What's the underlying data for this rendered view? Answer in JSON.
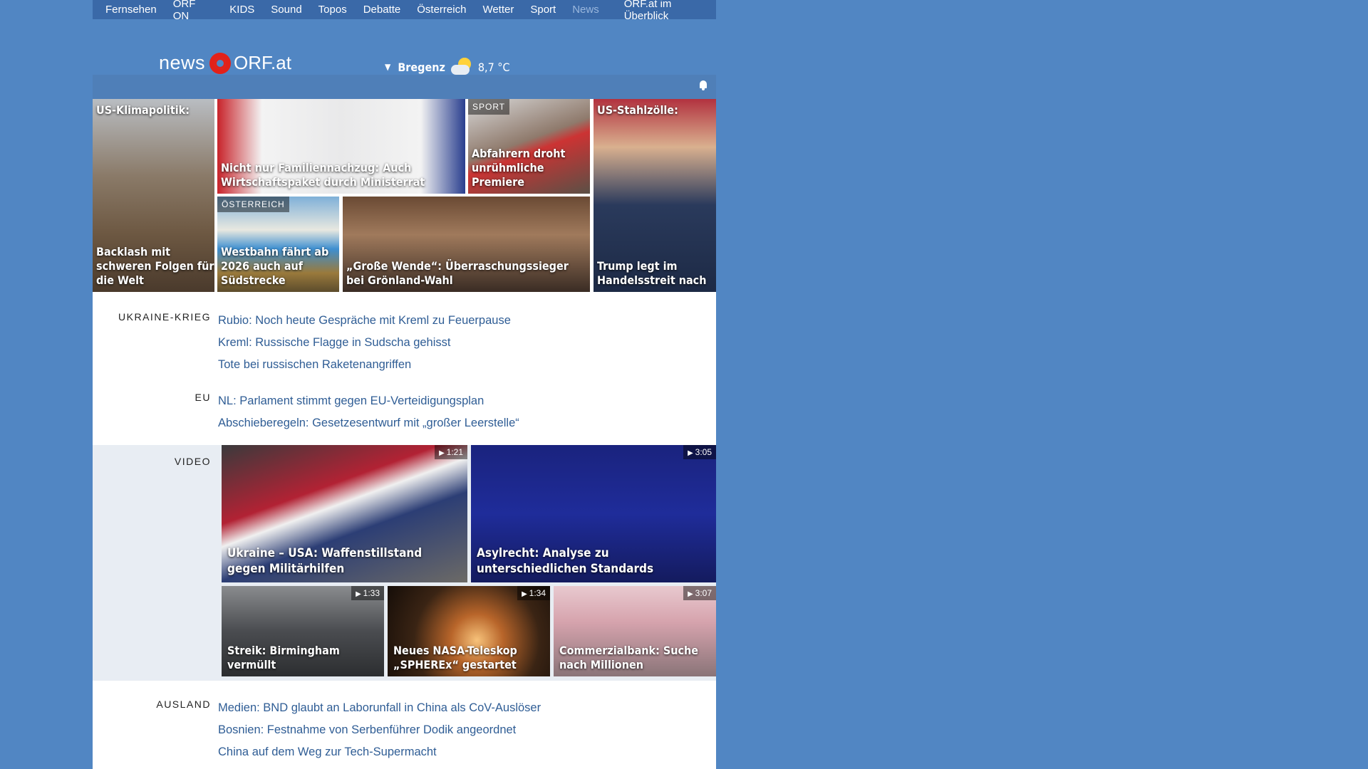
{
  "nav": {
    "items": [
      "Fernsehen",
      "ORF ON",
      "KIDS",
      "Sound",
      "Topos",
      "Debatte",
      "Österreich",
      "Wetter",
      "Sport"
    ],
    "active": "News",
    "overview": "ORF.at im Überblick"
  },
  "header": {
    "logo_news": "news",
    "logo_orf": "ORF.at",
    "weather_city": "Bregenz",
    "weather_temp": "8,7 °C",
    "weather_icon": "partly-sunny-icon"
  },
  "top_tiles": {
    "t1": {
      "top": "US-Klimapolitik:",
      "caption": "Backlash mit schweren Folgen für die Welt"
    },
    "t2": {
      "caption": "Nicht nur Familiennachzug: Auch Wirtschaftspaket durch Ministerrat"
    },
    "t3": {
      "tag": "SPORT",
      "caption": "Abfahrern droht unrühmliche Premiere"
    },
    "t4": {
      "top": "US-Stahlzölle:",
      "caption": "Trump legt im Handelsstreit nach"
    },
    "t5": {
      "tag": "ÖSTERREICH",
      "caption": "Westbahn fährt ab 2026 auch auf Südstrecke"
    },
    "t6": {
      "caption": "„Große Wende“: Überraschungssieger bei Grönland-Wahl"
    }
  },
  "sections": {
    "ukraine": {
      "label": "UKRAINE-KRIEG",
      "links": [
        "Rubio: Noch heute Gespräche mit Kreml zu Feuerpause",
        "Kreml: Russische Flagge in Sudscha gehisst",
        "Tote bei russischen Raketenangriffen"
      ]
    },
    "eu": {
      "label": "EU",
      "links": [
        "NL: Parlament stimmt gegen EU-Verteidigungsplan",
        "Abschieberegeln: Gesetzesentwurf mit „großer Leerstelle“"
      ]
    },
    "video": {
      "label": "VIDEO",
      "items": [
        {
          "caption": "Ukraine – USA: Waffenstillstand gegen Militärhilfen",
          "duration": "1:21"
        },
        {
          "caption": "Asylrecht: Analyse zu unterschiedlichen Standards",
          "duration": "3:05"
        },
        {
          "caption": "Streik: Birmingham vermüllt",
          "duration": "1:33"
        },
        {
          "caption": "Neues NASA-Teleskop „SPHEREx“ gestartet",
          "duration": "1:34"
        },
        {
          "caption": "Commerzialbank: Suche nach Millionen",
          "duration": "3:07"
        }
      ]
    },
    "ausland": {
      "label": "AUSLAND",
      "links": [
        "Medien: BND glaubt an Laborunfall in China als CoV-Auslöser",
        "Bosnien: Festnahme von Serbenführer Dodik angeordnet",
        "China auf dem Weg zur Tech-Supermacht"
      ]
    }
  }
}
